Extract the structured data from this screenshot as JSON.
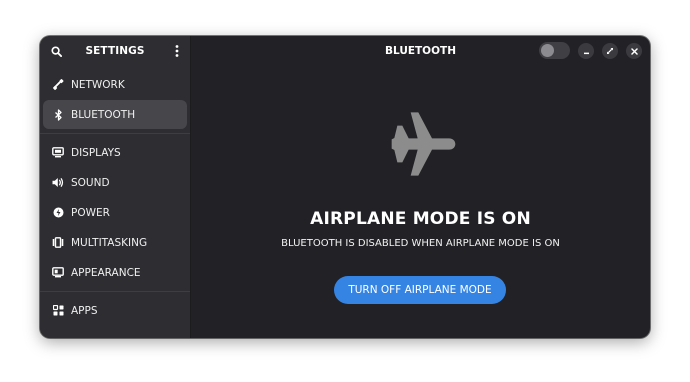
{
  "sidebar": {
    "title": "SETTINGS",
    "items": [
      {
        "label": "NETWORK",
        "icon": "network-icon"
      },
      {
        "label": "BLUETOOTH",
        "icon": "bluetooth-icon",
        "active": true
      },
      {
        "label": "DISPLAYS",
        "icon": "display-icon"
      },
      {
        "label": "SOUND",
        "icon": "sound-icon"
      },
      {
        "label": "POWER",
        "icon": "power-icon"
      },
      {
        "label": "MULTITASKING",
        "icon": "multitasking-icon"
      },
      {
        "label": "APPEARANCE",
        "icon": "appearance-icon"
      },
      {
        "label": "APPS",
        "icon": "apps-icon"
      }
    ]
  },
  "header": {
    "title": "BLUETOOTH",
    "bluetooth_toggle": "off"
  },
  "main": {
    "icon": "airplane-icon",
    "status_title": "AIRPLANE MODE IS ON",
    "status_description": "BLUETOOTH IS DISABLED WHEN AIRPLANE MODE IS ON",
    "action_label": "TURN OFF AIRPLANE MODE"
  },
  "colors": {
    "accent": "#3584e4",
    "window_bg": "#222226",
    "sidebar_bg": "#2e2e32",
    "active_item": "#46464b"
  }
}
